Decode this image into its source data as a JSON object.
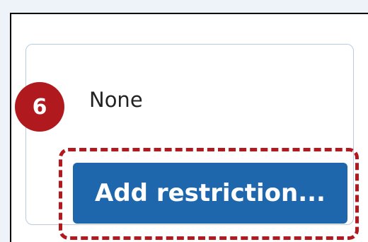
{
  "restrictions": {
    "status_text": "None",
    "add_button_label": "Add restriction..."
  },
  "annotation": {
    "step_number": "6",
    "highlight_color": "#b0191d"
  },
  "colors": {
    "button_background": "#1f67ac",
    "card_border": "#b9cde0",
    "page_background": "#eef3f9"
  }
}
